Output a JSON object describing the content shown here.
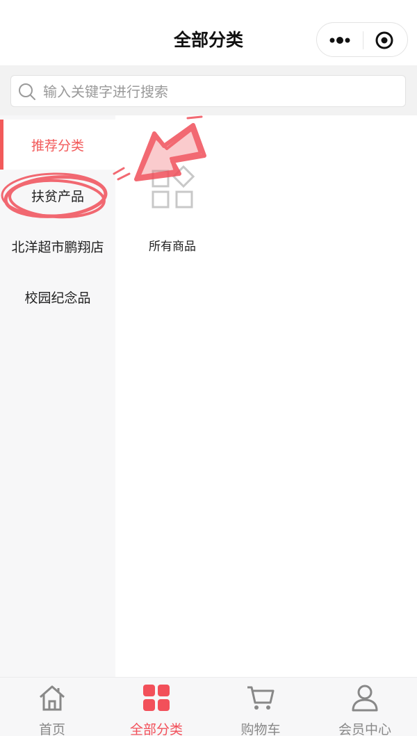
{
  "header": {
    "title": "全部分类"
  },
  "search": {
    "placeholder": "输入关键字进行搜索",
    "value": ""
  },
  "sidebar": {
    "items": [
      {
        "label": "推荐分类",
        "active": true
      },
      {
        "label": "扶贫产品",
        "active": false
      },
      {
        "label": "北洋超市鹏翔店",
        "active": false
      },
      {
        "label": "校园纪念品",
        "active": false
      }
    ]
  },
  "content": {
    "categories": [
      {
        "label": "所有商品",
        "icon": "grid-apps-icon"
      }
    ]
  },
  "tabbar": {
    "tabs": [
      {
        "label": "首页",
        "icon": "home-icon",
        "active": false
      },
      {
        "label": "全部分类",
        "icon": "category-grid-icon",
        "active": true
      },
      {
        "label": "购物车",
        "icon": "cart-icon",
        "active": false
      },
      {
        "label": "会员中心",
        "icon": "user-icon",
        "active": false
      }
    ]
  },
  "colors": {
    "accent": "#f25a5a",
    "annotation": "#f0505a",
    "sidebar_bg": "#f7f7f8"
  }
}
